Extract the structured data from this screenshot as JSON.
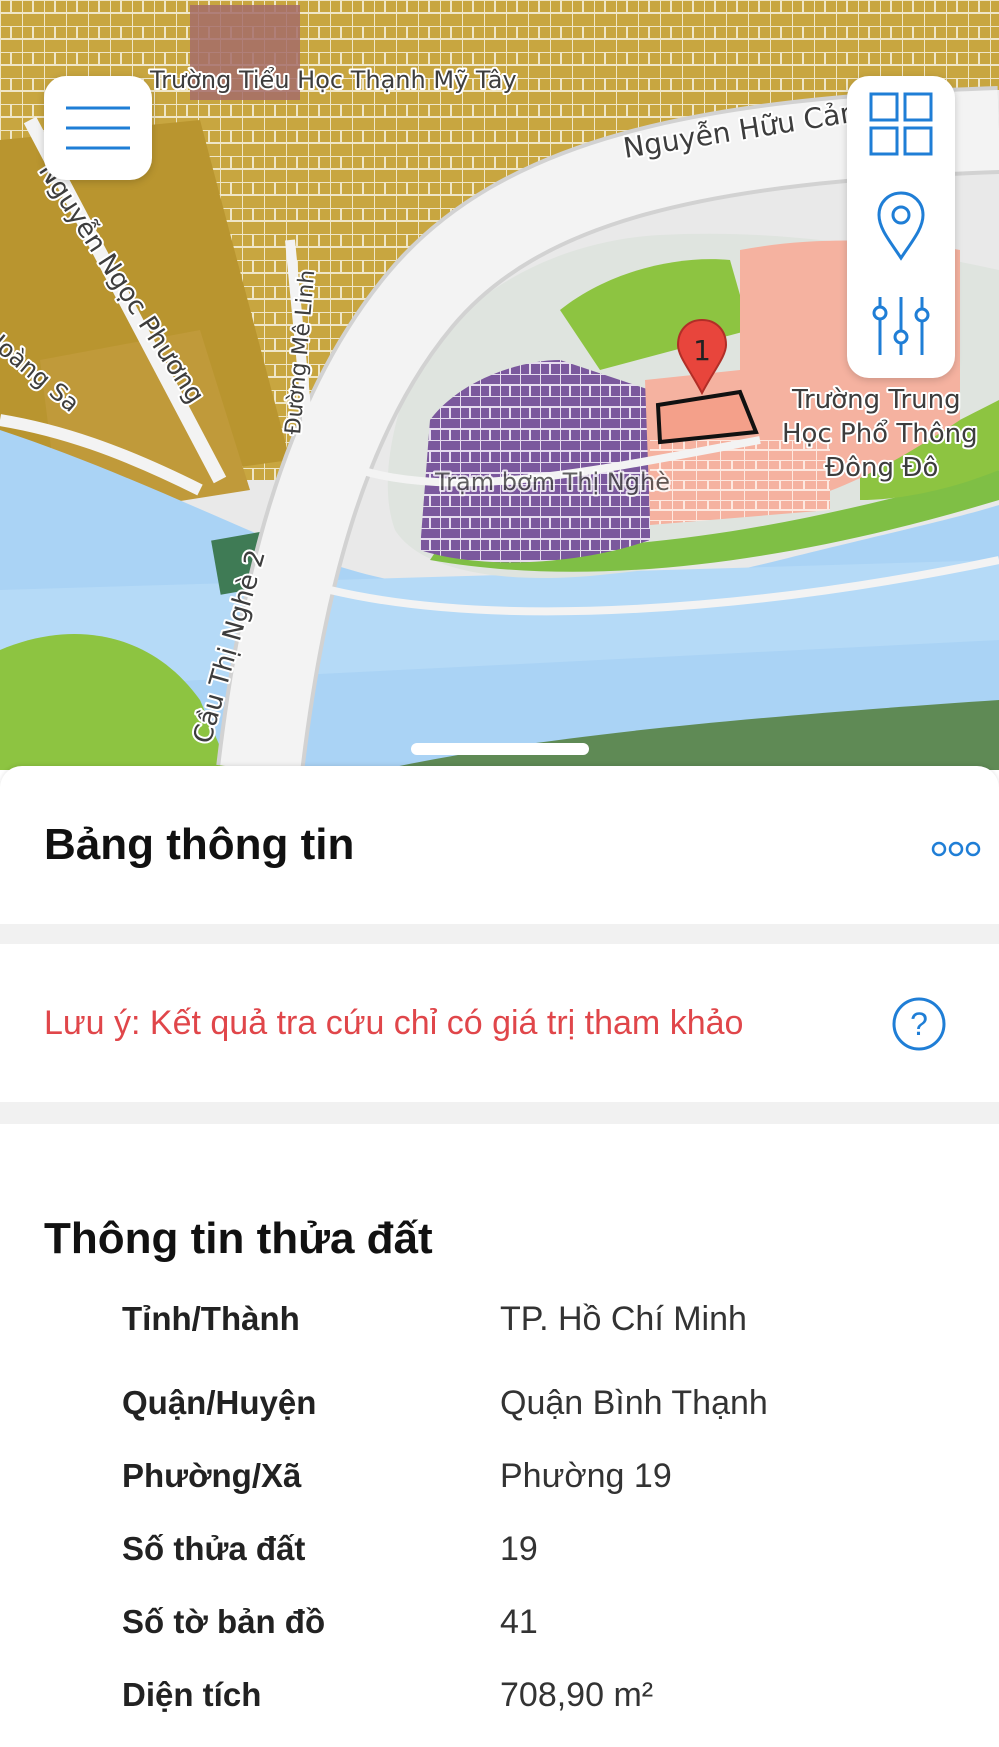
{
  "map": {
    "labels": {
      "school_top": "Trường Tiểu Học Thạnh Mỹ Tây",
      "road_nguyen_huu_canh": "Nguyễn Hữu Cảnh",
      "road_nguyen_ngoc_phuong": "Nguyễn Ngọc Phương",
      "road_me_linh": "Đường Mê Linh",
      "road_hoang_sa": "Hoàng Sa",
      "bridge_thi_nghe": "Cầu Thị Nghè 2",
      "school_right_1": "Trường Trung",
      "school_right_2": "Học Phổ Thông",
      "school_right_3": "Đông Đô",
      "area_label": "Trạm bơm Thị Nghè"
    },
    "marker_number": "1",
    "colors": {
      "residential": "#c8a640",
      "water": "#aad3f5",
      "park": "#8dc441",
      "purple": "#7b589d",
      "school": "#f5b2a0",
      "road": "#f3f3f3",
      "marker": "#e8453c"
    }
  },
  "buttons": {
    "menu_icon": "hamburger-menu-icon",
    "layers_icon": "layers-grid-icon",
    "location_icon": "location-pin-icon",
    "filter_icon": "sliders-filter-icon",
    "accent": "#1f7ed6"
  },
  "panel": {
    "title": "Bảng thông tin",
    "more_icon": "more-dots-icon",
    "note": "Lưu ý: Kết quả tra cứu chỉ có giá trị tham khảo",
    "help_symbol": "?",
    "note_color": "#e0464a"
  },
  "parcel": {
    "section_title": "Thông tin thửa đất",
    "rows": [
      {
        "label": "Tỉnh/Thành",
        "value": "TP. Hồ Chí Minh"
      },
      {
        "label": "Quận/Huyện",
        "value": "Quận Bình Thạnh"
      },
      {
        "label": "Phường/Xã",
        "value": "Phường 19"
      },
      {
        "label": "Số thửa đất",
        "value": "19"
      },
      {
        "label": "Số tờ bản đồ",
        "value": "41"
      },
      {
        "label": "Diện tích",
        "value": "708,90 m²"
      }
    ]
  }
}
